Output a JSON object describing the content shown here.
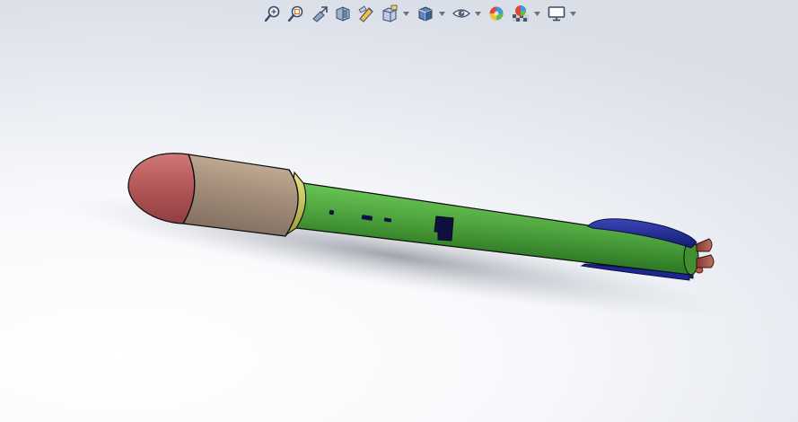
{
  "heads_up_toolbar": {
    "buttons": [
      {
        "icon": "zoom-to-fit-icon",
        "has_dropdown": false
      },
      {
        "icon": "zoom-to-area-icon",
        "has_dropdown": false
      },
      {
        "icon": "previous-view-icon",
        "has_dropdown": false
      },
      {
        "icon": "section-view-icon",
        "has_dropdown": false
      },
      {
        "icon": "dynamic-annotation-views-icon",
        "has_dropdown": false
      },
      {
        "icon": "view-orientation-icon",
        "has_dropdown": true
      },
      {
        "icon": "display-style-icon",
        "has_dropdown": true
      },
      {
        "icon": "hide-show-items-icon",
        "has_dropdown": true
      },
      {
        "icon": "edit-appearance-icon",
        "has_dropdown": false
      },
      {
        "icon": "apply-scene-icon",
        "has_dropdown": true
      },
      {
        "icon": "view-settings-icon",
        "has_dropdown": true
      }
    ]
  },
  "model": {
    "name": "rocket-assembly",
    "colors": {
      "nose_cone": "#b5595a",
      "payload_fairing": "#a58f7c",
      "coupler_ring": "#c9c35a",
      "body_tube": "#4fa43f",
      "fins": "#1d2790",
      "nozzles": "#a85447",
      "details": "#101040"
    }
  },
  "background": {
    "center": "#ffffff",
    "edge": "#d9dee7"
  }
}
